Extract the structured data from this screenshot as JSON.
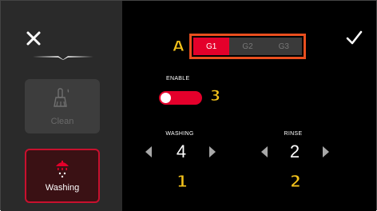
{
  "sidebar": {
    "clean": {
      "label": "Clean",
      "icon": "brush-icon",
      "state": "disabled"
    },
    "washing": {
      "label": "Washing",
      "icon": "shower-icon",
      "state": "selected"
    }
  },
  "header": {
    "close_icon": "close-icon",
    "confirm_icon": "checkmark-icon"
  },
  "groups": {
    "options": [
      "G1",
      "G2",
      "G3"
    ],
    "selected": "G1"
  },
  "enable": {
    "label": "ENABLE",
    "on": true
  },
  "washing": {
    "label": "WASHING",
    "value": "4"
  },
  "rinse": {
    "label": "RINSE",
    "value": "2"
  },
  "callouts": {
    "a": "A",
    "one": "1",
    "two": "2",
    "three": "3"
  },
  "colors": {
    "accent": "#e4002b",
    "callout": "#f3c21b",
    "callout_outline": "#e94f1f",
    "sidebar_bg": "#2a2a2a",
    "main_bg": "#000000"
  }
}
